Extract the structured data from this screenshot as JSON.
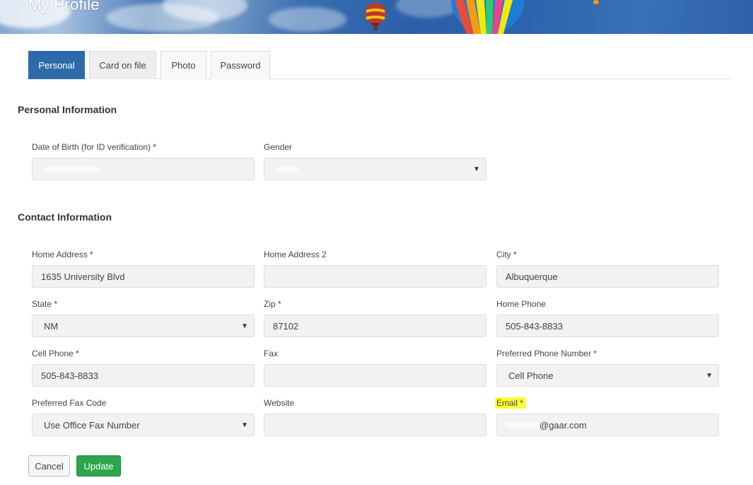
{
  "header": {
    "title": "My Profile"
  },
  "tabs": [
    {
      "label": "Personal",
      "active": true
    },
    {
      "label": "Card on file",
      "active": false
    },
    {
      "label": "Photo",
      "active": false
    },
    {
      "label": "Password",
      "active": false
    }
  ],
  "personal": {
    "section_title": "Personal Information",
    "dob": {
      "label": "Date of Birth (for ID verification) *",
      "value": ""
    },
    "gender": {
      "label": "Gender",
      "value": ""
    }
  },
  "contact": {
    "section_title": "Contact Information",
    "home_address": {
      "label": "Home Address *",
      "value": "1635 University Blvd"
    },
    "home_address2": {
      "label": "Home Address 2",
      "value": ""
    },
    "city": {
      "label": "City *",
      "value": "Albuquerque"
    },
    "state": {
      "label": "State *",
      "value": "NM"
    },
    "zip": {
      "label": "Zip *",
      "value": "87102"
    },
    "home_phone": {
      "label": "Home Phone",
      "value": "505-843-8833"
    },
    "cell_phone": {
      "label": "Cell Phone *",
      "value": "505-843-8833"
    },
    "fax": {
      "label": "Fax",
      "value": ""
    },
    "preferred_phone": {
      "label": "Preferred Phone Number *",
      "value": "Cell Phone"
    },
    "preferred_fax": {
      "label": "Preferred Fax Code",
      "value": "Use Office Fax Number"
    },
    "website": {
      "label": "Website",
      "value": ""
    },
    "email": {
      "label": "Email *",
      "value": "@gaar.com"
    }
  },
  "buttons": {
    "cancel": "Cancel",
    "update": "Update"
  },
  "colors": {
    "primary_tab": "#2f6aa8",
    "update_button": "#2da44e",
    "highlight": "#ffff33"
  },
  "icons": {
    "select_caret": "caret-down-icon"
  }
}
